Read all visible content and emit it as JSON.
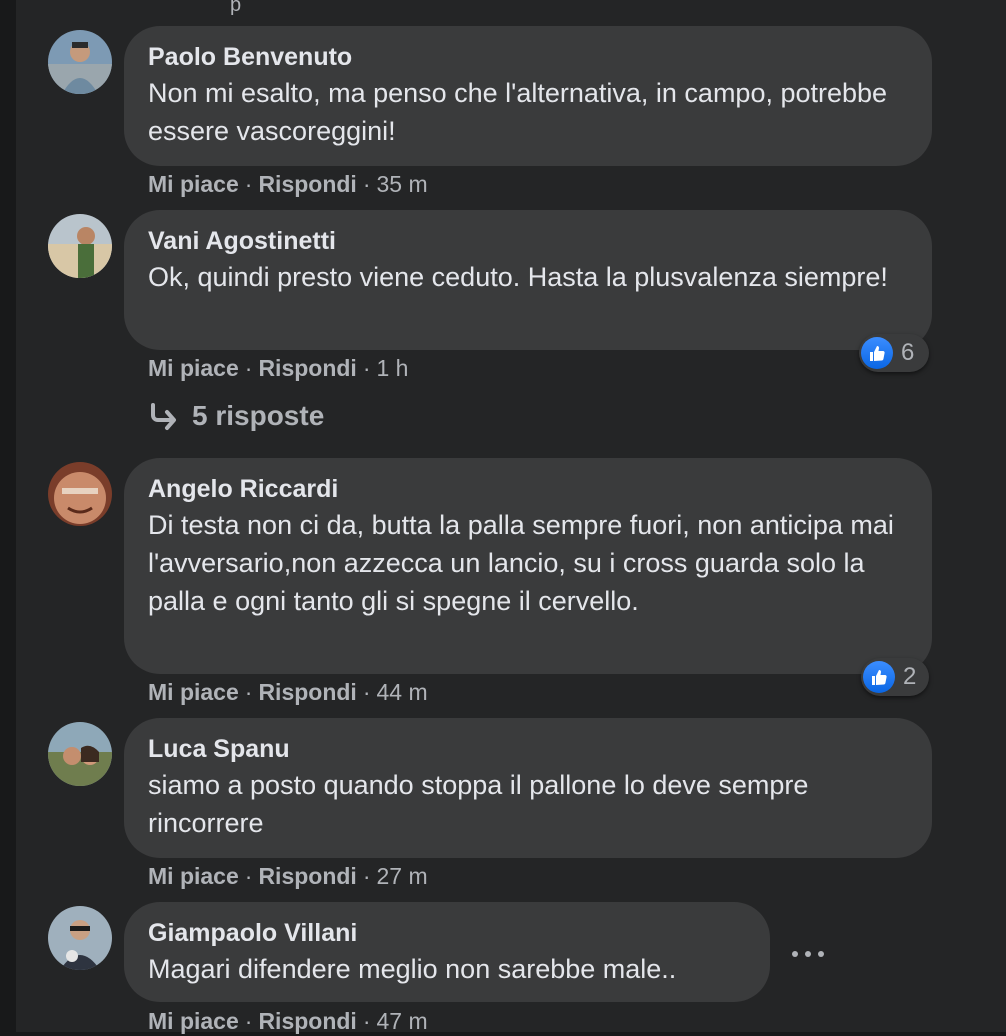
{
  "top_partial_text": "p",
  "comments": [
    {
      "author": "Paolo Benvenuto",
      "text": "Non mi esalto, ma penso che l'alternativa, in campo, potrebbe essere vascoreggini!",
      "like_label": "Mi piace",
      "reply_label": "Rispondi",
      "time": "35 m"
    },
    {
      "author": "Vani Agostinetti",
      "text": "Ok, quindi presto viene ceduto. Hasta la plusvalenza siempre!",
      "like_label": "Mi piace",
      "reply_label": "Rispondi",
      "time": "1 h",
      "reactions": "6",
      "replies_label": "5 risposte"
    },
    {
      "author": "Angelo Riccardi",
      "text": "Di testa non ci da, butta la palla sempre fuori, non anticipa mai l'avversario,non azzecca un lancio, su i cross guarda solo la palla e ogni tanto gli si spegne il cervello.",
      "like_label": "Mi piace",
      "reply_label": "Rispondi",
      "time": "44 m",
      "reactions": "2"
    },
    {
      "author": "Luca Spanu",
      "text": "siamo a posto quando stoppa il pallone lo deve sempre rincorrere",
      "like_label": "Mi piace",
      "reply_label": "Rispondi",
      "time": "27 m"
    },
    {
      "author": "Giampaolo Villani",
      "text": "Magari difendere meglio non sarebbe male..",
      "like_label": "Mi piace",
      "reply_label": "Rispondi",
      "time": "47 m"
    }
  ],
  "colors": {
    "page_bg": "#18191a",
    "panel_bg": "#242526",
    "bubble_bg": "#3a3b3c",
    "text_primary": "#e4e6eb",
    "text_secondary": "#b0b3b8",
    "like_blue": "#1877f2"
  },
  "icons": [
    "like-thumb-icon",
    "reply-arrow-icon",
    "more-options-icon"
  ]
}
